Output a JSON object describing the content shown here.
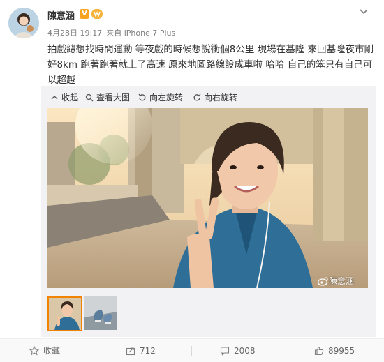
{
  "post": {
    "username": "陳意涵",
    "verified_badge": "V",
    "timestamp": "4月28日 19:17",
    "source": "来自 iPhone 7 Plus",
    "text": "拍戲總想找時間運動 等夜戲的時候想說衝個8公里 現場在基隆 來回基隆夜市剛好8km 跑著跑著就上了高速 原來地圖路線設成車啦 哈哈 自己的笨只有自己可以超越"
  },
  "toolbar": {
    "collect": "收起",
    "view_large": "查看大图",
    "rotate_left": "向左旋转",
    "rotate_right": "向右旋转"
  },
  "watermark": "陳意涵",
  "footer": {
    "favorite": "收藏",
    "repost_count": "712",
    "comment_count": "2008",
    "like_count": "89955"
  },
  "icons": {
    "chevron": "chevron-down-icon",
    "collect": "collapse-icon",
    "view_large": "magnifier-icon",
    "rotate_left": "rotate-left-icon",
    "rotate_right": "rotate-right-icon",
    "favorite": "star-icon",
    "repost": "share-icon",
    "comment": "comment-icon",
    "like": "thumbs-up-icon"
  },
  "colors": {
    "accent_orange": "#f08300",
    "badge_gold": "#f7a51e"
  }
}
